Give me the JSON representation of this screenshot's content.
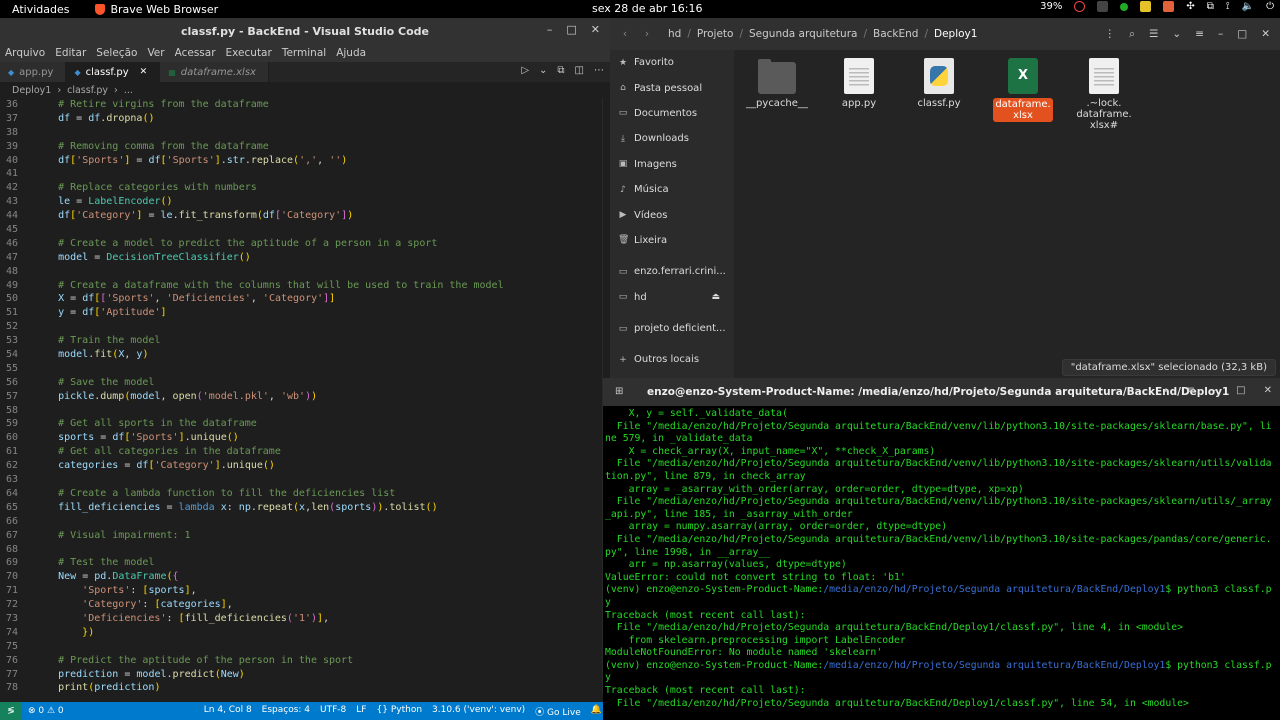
{
  "topbar": {
    "activities": "Atividades",
    "app": "Brave Web Browser",
    "clock": "sex 28 de abr  16:16",
    "battery": "39%"
  },
  "vscode": {
    "title": "classf.py - BackEnd - Visual Studio Code",
    "menu": [
      "Arquivo",
      "Editar",
      "Seleção",
      "Ver",
      "Acessar",
      "Executar",
      "Terminal",
      "Ajuda"
    ],
    "tabs": [
      {
        "label": "app.py",
        "active": false,
        "italic": false
      },
      {
        "label": "classf.py",
        "active": true,
        "italic": false
      },
      {
        "label": "dataframe.xlsx",
        "active": false,
        "italic": true
      }
    ],
    "breadcrumb": [
      "Deploy1",
      "classf.py",
      "..."
    ],
    "code_lines": [
      {
        "n": "36",
        "t": "    # Retire virgins from the dataframe",
        "k": "comment"
      },
      {
        "n": "37",
        "t": "    df = df.dropna()",
        "k": "code"
      },
      {
        "n": "38",
        "t": "",
        "k": "code"
      },
      {
        "n": "39",
        "t": "    # Removing comma from the dataframe",
        "k": "comment"
      },
      {
        "n": "40",
        "t": "    df['Sports'] = df['Sports'].str.replace(',', '')",
        "k": "code"
      },
      {
        "n": "41",
        "t": "",
        "k": "code"
      },
      {
        "n": "42",
        "t": "    # Replace categories with numbers",
        "k": "comment"
      },
      {
        "n": "43",
        "t": "    le = LabelEncoder()",
        "k": "code"
      },
      {
        "n": "44",
        "t": "    df['Category'] = le.fit_transform(df['Category'])",
        "k": "code"
      },
      {
        "n": "45",
        "t": "",
        "k": "code"
      },
      {
        "n": "46",
        "t": "    # Create a model to predict the aptitude of a person in a sport",
        "k": "comment"
      },
      {
        "n": "47",
        "t": "    model = DecisionTreeClassifier()",
        "k": "code"
      },
      {
        "n": "48",
        "t": "",
        "k": "code"
      },
      {
        "n": "49",
        "t": "    # Create a dataframe with the columns that will be used to train the model",
        "k": "comment"
      },
      {
        "n": "50",
        "t": "    X = df[['Sports', 'Deficiencies', 'Category']]",
        "k": "code"
      },
      {
        "n": "51",
        "t": "    y = df['Aptitude']",
        "k": "code"
      },
      {
        "n": "52",
        "t": "",
        "k": "code"
      },
      {
        "n": "53",
        "t": "    # Train the model",
        "k": "comment"
      },
      {
        "n": "54",
        "t": "    model.fit(X, y)",
        "k": "code"
      },
      {
        "n": "55",
        "t": "",
        "k": "code"
      },
      {
        "n": "56",
        "t": "    # Save the model",
        "k": "comment"
      },
      {
        "n": "57",
        "t": "    pickle.dump(model, open('model.pkl', 'wb'))",
        "k": "code"
      },
      {
        "n": "58",
        "t": "",
        "k": "code"
      },
      {
        "n": "59",
        "t": "    # Get all sports in the dataframe",
        "k": "comment"
      },
      {
        "n": "60",
        "t": "    sports = df['Sports'].unique()",
        "k": "code"
      },
      {
        "n": "61",
        "t": "    # Get all categories in the dataframe",
        "k": "comment"
      },
      {
        "n": "62",
        "t": "    categories = df['Category'].unique()",
        "k": "code"
      },
      {
        "n": "63",
        "t": "",
        "k": "code"
      },
      {
        "n": "64",
        "t": "    # Create a lambda function to fill the deficiencies list",
        "k": "comment"
      },
      {
        "n": "65",
        "t": "    fill_deficiencies = lambda x: np.repeat(x,len(sports)).tolist()",
        "k": "code"
      },
      {
        "n": "66",
        "t": "",
        "k": "code"
      },
      {
        "n": "67",
        "t": "    # Visual impairment: 1",
        "k": "comment"
      },
      {
        "n": "68",
        "t": "",
        "k": "code"
      },
      {
        "n": "69",
        "t": "    # Test the model",
        "k": "comment"
      },
      {
        "n": "70",
        "t": "    New = pd.DataFrame({",
        "k": "code"
      },
      {
        "n": "71",
        "t": "        'Sports': [sports],",
        "k": "code"
      },
      {
        "n": "72",
        "t": "        'Category': [categories],",
        "k": "code"
      },
      {
        "n": "73",
        "t": "        'Deficiencies': [fill_deficiencies('1')],",
        "k": "code"
      },
      {
        "n": "74",
        "t": "        })",
        "k": "code"
      },
      {
        "n": "75",
        "t": "",
        "k": "code"
      },
      {
        "n": "76",
        "t": "    # Predict the aptitude of the person in the sport",
        "k": "comment"
      },
      {
        "n": "77",
        "t": "    prediction = model.predict(New)",
        "k": "code"
      },
      {
        "n": "78",
        "t": "    print(prediction)",
        "k": "code"
      }
    ],
    "status": {
      "problems": "⊗ 0 ⚠ 0",
      "position": "Ln 4, Col 8",
      "spaces": "Espaços: 4",
      "encoding": "UTF-8",
      "eol": "LF",
      "language": "Python",
      "interpreter": "3.10.6 ('venv': venv)",
      "golive": "Go Live"
    }
  },
  "files": {
    "path": [
      "hd",
      "Projeto",
      "Segunda arquitetura",
      "BackEnd",
      "Deploy1"
    ],
    "sidebar": [
      {
        "label": "Favorito",
        "icon": "★"
      },
      {
        "label": "Pasta pessoal",
        "icon": "⌂"
      },
      {
        "label": "Documentos",
        "icon": "▭"
      },
      {
        "label": "Downloads",
        "icon": "⤓"
      },
      {
        "label": "Imagens",
        "icon": "▣"
      },
      {
        "label": "Música",
        "icon": "♪"
      },
      {
        "label": "Vídeos",
        "icon": "▶"
      },
      {
        "label": "Lixeira",
        "icon": "🗑"
      },
      {
        "label": "enzo.ferrari.crini...",
        "icon": "▭"
      },
      {
        "label": "hd",
        "icon": "▭"
      },
      {
        "label": "projeto deficient...",
        "icon": "▭"
      },
      {
        "label": "Outros locais",
        "icon": "+"
      }
    ],
    "items": [
      {
        "name": "__pycache__",
        "type": "folder",
        "selected": false
      },
      {
        "name": "app.py",
        "type": "doc",
        "selected": false
      },
      {
        "name": "classf.py",
        "type": "py",
        "selected": false
      },
      {
        "name": "dataframe.\nxlsx",
        "type": "xls",
        "selected": true
      },
      {
        "name": ".~lock.\ndataframe.\nxlsx#",
        "type": "doc",
        "selected": false
      }
    ],
    "status": "\"dataframe.xlsx\" selecionado (32,3 kB)"
  },
  "terminal": {
    "title": "enzo@enzo-System-Product-Name: /media/enzo/hd/Projeto/Segunda arquitetura/BackEnd/Deploy1",
    "lines": [
      {
        "t": "    X, y = self._validate_data("
      },
      {
        "t": "  File \"/media/enzo/hd/Projeto/Segunda arquitetura/BackEnd/venv/lib/python3.10/site-packages/sklearn/base.py\", line 579, in _validate_data"
      },
      {
        "t": "    X = check_array(X, input_name=\"X\", **check_X_params)"
      },
      {
        "t": "  File \"/media/enzo/hd/Projeto/Segunda arquitetura/BackEnd/venv/lib/python3.10/site-packages/sklearn/utils/validation.py\", line 879, in check_array"
      },
      {
        "t": "    array = _asarray_with_order(array, order=order, dtype=dtype, xp=xp)"
      },
      {
        "t": "  File \"/media/enzo/hd/Projeto/Segunda arquitetura/BackEnd/venv/lib/python3.10/site-packages/sklearn/utils/_array_api.py\", line 185, in _asarray_with_order"
      },
      {
        "t": "    array = numpy.asarray(array, order=order, dtype=dtype)"
      },
      {
        "t": "  File \"/media/enzo/hd/Projeto/Segunda arquitetura/BackEnd/venv/lib/python3.10/site-packages/pandas/core/generic.py\", line 1998, in __array__"
      },
      {
        "t": "    arr = np.asarray(values, dtype=dtype)"
      },
      {
        "t": "ValueError: could not convert string to float: 'b1'"
      },
      {
        "t": "(venv) enzo@enzo-System-Product-Name:",
        "path": "/media/enzo/hd/Projeto/Segunda arquitetura/BackEnd/Deploy1",
        "cmd": "$ python3 classf.py"
      },
      {
        "t": "Traceback (most recent call last):"
      },
      {
        "t": "  File \"/media/enzo/hd/Projeto/Segunda arquitetura/BackEnd/Deploy1/classf.py\", line 4, in <module>"
      },
      {
        "t": "    from skelearn.preprocessing import LabelEncoder"
      },
      {
        "t": "ModuleNotFoundError: No module named 'skelearn'"
      },
      {
        "t": "(venv) enzo@enzo-System-Product-Name:",
        "path": "/media/enzo/hd/Projeto/Segunda arquitetura/BackEnd/Deploy1",
        "cmd": "$ python3 classf.py"
      },
      {
        "t": "Traceback (most recent call last):"
      },
      {
        "t": "  File \"/media/enzo/hd/Projeto/Segunda arquitetura/BackEnd/Deploy1/classf.py\", line 54, in <module>"
      }
    ]
  }
}
